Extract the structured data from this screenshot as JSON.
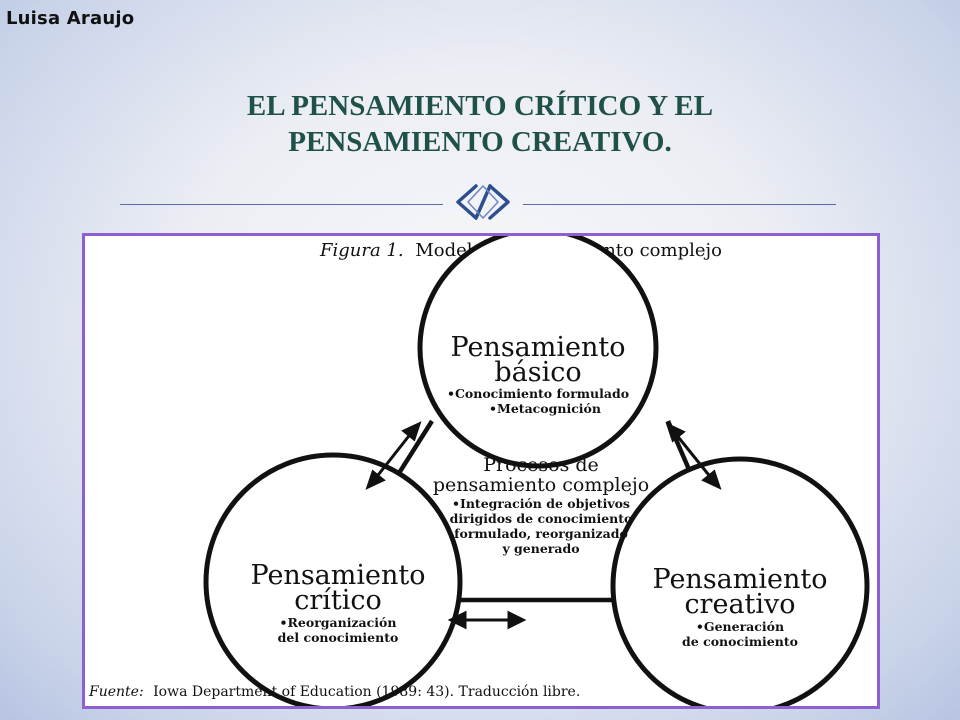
{
  "author": "Luisa Araujo",
  "title": {
    "line1": "EL PENSAMIENTO CRÍTICO Y EL",
    "line2": "PENSAMIENTO CREATIVO."
  },
  "figure": {
    "caption_label": "Figura 1.",
    "caption_text": "Modelo de pensamiento complejo",
    "center": {
      "title_line1": "Procesos de",
      "title_line2": "pensamiento complejo",
      "desc_line1": "•Integración de objetivos",
      "desc_line2": "dirigidos de conocimiento",
      "desc_line3": "formulado, reorganizado",
      "desc_line4": "y generado"
    },
    "basico": {
      "title_line1": "Pensamiento",
      "title_line2": "básico",
      "item1": "•Conocimiento formulado",
      "item2": "•Metacognición"
    },
    "critico": {
      "title_line1": "Pensamiento",
      "title_line2": "crítico",
      "item1": "•Reorganización",
      "item2": "del conocimiento"
    },
    "creativo": {
      "title_line1": "Pensamiento",
      "title_line2": "creativo",
      "item1": "•Generación",
      "item2": "de conocimiento"
    },
    "source_label": "Fuente:",
    "source_text": "Iowa Department of Education (1989: 43). Traducción libre."
  },
  "colors": {
    "title": "#1f5148",
    "frame": "#8e5fcf",
    "rule": "#5a6da6"
  },
  "icons": [
    "ornament-icon",
    "double-arrow-icon"
  ]
}
